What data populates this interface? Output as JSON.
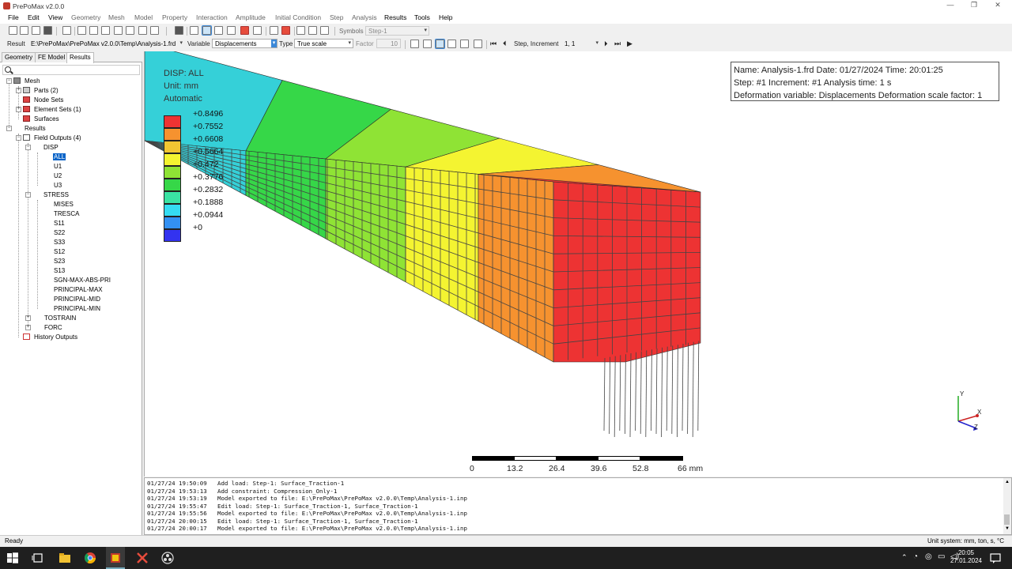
{
  "window": {
    "title": "PrePoMax v2.0.0"
  },
  "menu": [
    "File",
    "Edit",
    "View",
    "Geometry",
    "Mesh",
    "Model",
    "Property",
    "Interaction",
    "Amplitude",
    "Initial Condition",
    "Step",
    "Analysis",
    "Results",
    "Tools",
    "Help"
  ],
  "toolbar1": {
    "symbols_label": "Symbols",
    "symbols_value": "Step-1"
  },
  "toolbar2": {
    "result_label": "Result",
    "result_value": "E:\\PrePoMax\\PrePoMax v2.0.0\\Temp\\Analysis-1.frd",
    "variable_label": "Variable",
    "variable_value": "Displacements",
    "type_label": "Type",
    "type_value": "True scale",
    "factor_label": "Factor",
    "factor_value": "10",
    "step_label": "Step, Increment",
    "step_value": "1, 1"
  },
  "tabs": [
    "Geometry",
    "FE Model",
    "Results"
  ],
  "active_tab": "Results",
  "tree": {
    "mesh": "Mesh",
    "parts": "Parts (2)",
    "node_sets": "Node Sets",
    "element_sets": "Element Sets (1)",
    "surfaces": "Surfaces",
    "results": "Results",
    "field_outputs": "Field Outputs (4)",
    "disp": "DISP",
    "disp_items": [
      "ALL",
      "U1",
      "U2",
      "U3"
    ],
    "stress": "STRESS",
    "stress_items": [
      "MISES",
      "TRESCA",
      "S11",
      "S22",
      "S33",
      "S12",
      "S23",
      "S13",
      "SGN-MAX-ABS-PRI",
      "PRINCIPAL-MAX",
      "PRINCIPAL-MID",
      "PRINCIPAL-MIN"
    ],
    "tostrain": "TOSTRAIN",
    "forc": "FORC",
    "history_outputs": "History Outputs"
  },
  "legend": {
    "title": "DISP: ALL",
    "unit": "Unit: mm",
    "mode": "Automatic",
    "values": [
      "+0.8496",
      "+0.7552",
      "+0.6608",
      "+0.5664",
      "+0.472",
      "+0.3776",
      "+0.2832",
      "+0.1888",
      "+0.0944",
      "+0"
    ],
    "colors": [
      "#ed3333",
      "#f6922f",
      "#f2c632",
      "#f4f431",
      "#8fe335",
      "#36d748",
      "#3ae3a3",
      "#35dcf2",
      "#3391f3",
      "#3333f0"
    ]
  },
  "info": {
    "line1": "Name: Analysis-1.frd   Date: 01/27/2024   Time: 20:01:25",
    "line2": "Step: #1    Increment: #1    Analysis time: 1 s",
    "line3": "Deformation variable: Displacements    Deformation scale factor: 1"
  },
  "scale": {
    "labels": [
      "0",
      "13.2",
      "26.4",
      "39.6",
      "52.8",
      "66 mm"
    ]
  },
  "triad": {
    "y": "Y",
    "x": "X",
    "z": "Z"
  },
  "console": [
    "01/27/24 19:50:09   Add load: Step-1: Surface_Traction-1",
    "01/27/24 19:53:13   Add constraint: Compression_Only-1",
    "01/27/24 19:53:19   Model exported to file: E:\\PrePoMax\\PrePoMax v2.0.0\\Temp\\Analysis-1.inp",
    "01/27/24 19:55:47   Edit load: Step-1: Surface_Traction-1, Surface_Traction-1",
    "01/27/24 19:55:56   Model exported to file: E:\\PrePoMax\\PrePoMax v2.0.0\\Temp\\Analysis-1.inp",
    "01/27/24 20:00:15   Edit load: Step-1: Surface_Traction-1, Surface_Traction-1",
    "01/27/24 20:00:17   Model exported to file: E:\\PrePoMax\\PrePoMax v2.0.0\\Temp\\Analysis-1.inp"
  ],
  "status": {
    "left": "Ready",
    "right": "Unit system: mm, ton, s, °C"
  },
  "clock": {
    "time": "20:05",
    "date": "27.01.2024"
  }
}
